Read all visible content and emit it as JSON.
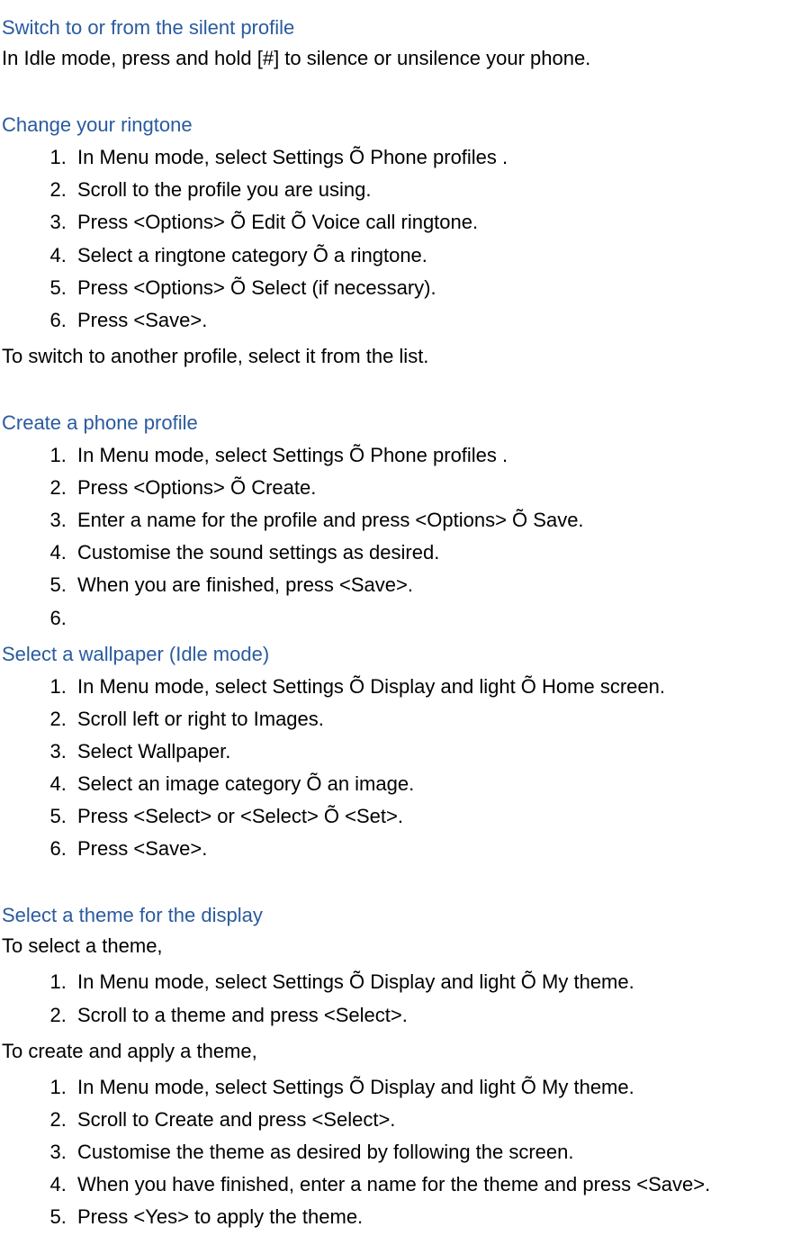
{
  "section1": {
    "heading": "Switch to or from the silent profile",
    "para": "In Idle mode, press and hold [#] to silence or unsilence your phone."
  },
  "section2": {
    "heading": "Change your ringtone",
    "steps": [
      "In Menu mode, select Settings Õ Phone profiles .",
      "Scroll to the profile you are using.",
      "Press <Options> Õ Edit Õ Voice call ringtone.",
      "Select a ringtone category Õ a ringtone.",
      "Press <Options> Õ Select (if necessary).",
      "Press <Save>."
    ],
    "after": "To switch to another profile, select it from the list."
  },
  "section3": {
    "heading": "Create a phone profile",
    "steps": [
      "In Menu mode, select Settings Õ Phone profiles .",
      "Press <Options> Õ Create.",
      "Enter a name for the profile and press <Options> Õ Save.",
      "Customise the sound settings as desired.",
      "When you are finished, press <Save>.",
      ""
    ]
  },
  "section4": {
    "heading": "Select a wallpaper (Idle mode)",
    "steps": [
      "In Menu mode, select Settings Õ Display and light Õ Home screen.",
      "Scroll left or right to Images.",
      "Select Wallpaper.",
      "Select an image category Õ an image.",
      "Press <Select> or <Select> Õ <Set>.",
      "Press <Save>."
    ]
  },
  "section5": {
    "heading": "Select a theme for the display",
    "intro": "To select a theme,",
    "steps1": [
      "In Menu mode, select Settings Õ Display and light Õ My theme.",
      "Scroll to a theme and press <Select>."
    ],
    "mid": "To create and apply a theme,",
    "steps2": [
      "In Menu mode, select Settings Õ Display and light Õ My theme.",
      "Scroll to Create and press <Select>.",
      "Customise the theme as desired by following the screen.",
      "When you have finished, enter a name for the theme and press <Save>.",
      "Press <Yes> to apply the theme."
    ]
  }
}
